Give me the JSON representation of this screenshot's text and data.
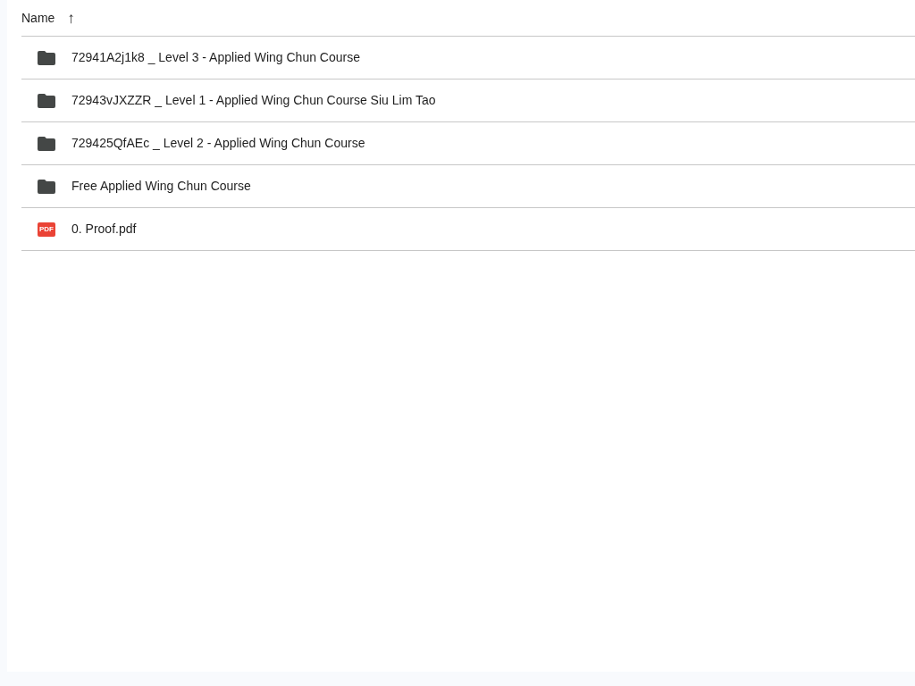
{
  "table": {
    "columns": [
      {
        "label": "Name",
        "sort_icon": "↑"
      }
    ],
    "rows": [
      {
        "kind": "folder",
        "name": "72941A2j1k8 _ Level 3 - Applied Wing Chun Course"
      },
      {
        "kind": "folder",
        "name": "72943vJXZZR _ Level 1 - Applied Wing Chun Course Siu Lim Tao"
      },
      {
        "kind": "folder",
        "name": "729425QfAEc _ Level 2 - Applied Wing Chun Course"
      },
      {
        "kind": "folder",
        "name": "Free Applied Wing Chun Course"
      },
      {
        "kind": "pdf",
        "name": "0. Proof.pdf",
        "icon_label": "PDF"
      }
    ]
  }
}
